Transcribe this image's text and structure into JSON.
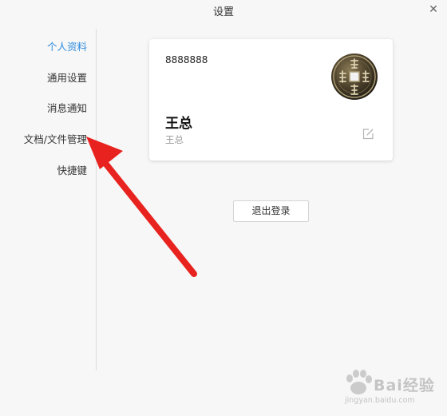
{
  "window": {
    "title": "设置",
    "close_glyph": "✕"
  },
  "sidebar": {
    "items": [
      {
        "label": "个人资料",
        "active": true
      },
      {
        "label": "通用设置",
        "active": false
      },
      {
        "label": "消息通知",
        "active": false
      },
      {
        "label": "文档/文件管理",
        "active": false
      },
      {
        "label": "快捷键",
        "active": false
      }
    ]
  },
  "profile": {
    "account_id": "8888888",
    "display_name": "王总",
    "sub_name": "王总",
    "avatar_icon": "coin-avatar-icon",
    "edit_icon": "edit-icon"
  },
  "actions": {
    "logout_label": "退出登录"
  },
  "annotation": {
    "color": "#e8231f"
  },
  "watermark": {
    "text": "Bai经验",
    "url": "jingyan.baidu.com"
  },
  "colors": {
    "accent": "#2f8ee0",
    "background": "#f7f7f7",
    "card": "#ffffff"
  }
}
